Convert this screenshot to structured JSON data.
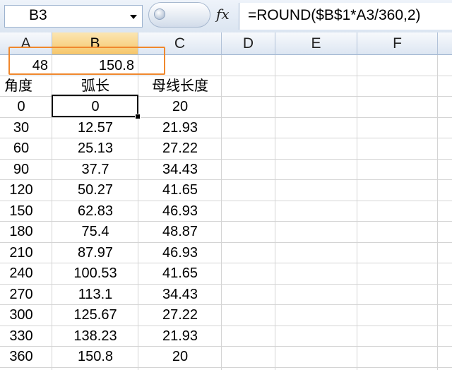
{
  "formula_bar": {
    "name_box": "B3",
    "fx": "fx",
    "formula": "=ROUND($B$1*A3/360,2)"
  },
  "columns": [
    "A",
    "B",
    "C",
    "D",
    "E",
    "F"
  ],
  "selected_column": "B",
  "row1": {
    "a": "48",
    "b": "150.8"
  },
  "headers": {
    "a": "角度",
    "b": "弧长",
    "c": "母线长度"
  },
  "rows": [
    {
      "a": "0",
      "b": "0",
      "c": "20"
    },
    {
      "a": "30",
      "b": "12.57",
      "c": "21.93"
    },
    {
      "a": "60",
      "b": "25.13",
      "c": "27.22"
    },
    {
      "a": "90",
      "b": "37.7",
      "c": "34.43"
    },
    {
      "a": "120",
      "b": "50.27",
      "c": "41.65"
    },
    {
      "a": "150",
      "b": "62.83",
      "c": "46.93"
    },
    {
      "a": "180",
      "b": "75.4",
      "c": "48.87"
    },
    {
      "a": "210",
      "b": "87.97",
      "c": "46.93"
    },
    {
      "a": "240",
      "b": "100.53",
      "c": "41.65"
    },
    {
      "a": "270",
      "b": "113.1",
      "c": "34.43"
    },
    {
      "a": "300",
      "b": "125.67",
      "c": "27.22"
    },
    {
      "a": "330",
      "b": "138.23",
      "c": "21.93"
    },
    {
      "a": "360",
      "b": "150.8",
      "c": "20"
    }
  ],
  "colors": {
    "highlight": "#f0882d",
    "selected_header": "#f6c66a",
    "gridline": "#d4d4d4"
  }
}
